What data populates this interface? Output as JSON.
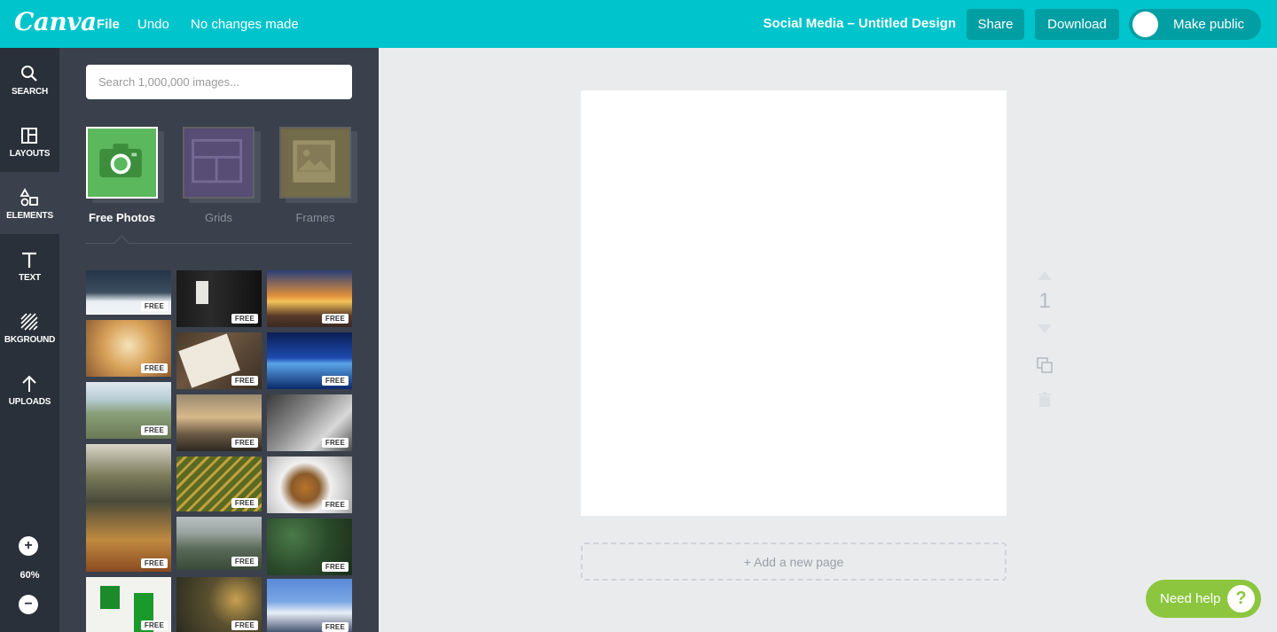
{
  "topbar": {
    "logo": "Canva",
    "menu": {
      "file": "File",
      "undo": "Undo",
      "status": "No changes made"
    },
    "design_title": "Social Media – Untitled Design",
    "share_label": "Share",
    "download_label": "Download",
    "make_public_label": "Make public",
    "make_public_on": false
  },
  "rail": {
    "items": [
      {
        "label": "SEARCH",
        "icon": "search-icon"
      },
      {
        "label": "LAYOUTS",
        "icon": "layouts-icon"
      },
      {
        "label": "ELEMENTS",
        "icon": "elements-icon",
        "active": true
      },
      {
        "label": "TEXT",
        "icon": "text-icon"
      },
      {
        "label": "BKGROUND",
        "icon": "background-icon"
      },
      {
        "label": "UPLOADS",
        "icon": "uploads-icon"
      }
    ],
    "zoom": {
      "plus": "+",
      "level": "60%",
      "minus": "−"
    }
  },
  "panel": {
    "search_placeholder": "Search 1,000,000 images...",
    "categories": [
      {
        "label": "Free Photos",
        "icon": "camera-icon",
        "selected": true
      },
      {
        "label": "Grids",
        "icon": "grid-icon"
      },
      {
        "label": "Frames",
        "icon": "frame-icon"
      }
    ],
    "free_badge": "FREE"
  },
  "canvas": {
    "page_number": "1",
    "add_page_label": "+ Add a new page"
  },
  "help": {
    "label": "Need help",
    "icon": "?"
  },
  "colors": {
    "brand": "#00c4cc",
    "rail": "#293039",
    "panel": "#3a414c",
    "help": "#8cc63f"
  }
}
